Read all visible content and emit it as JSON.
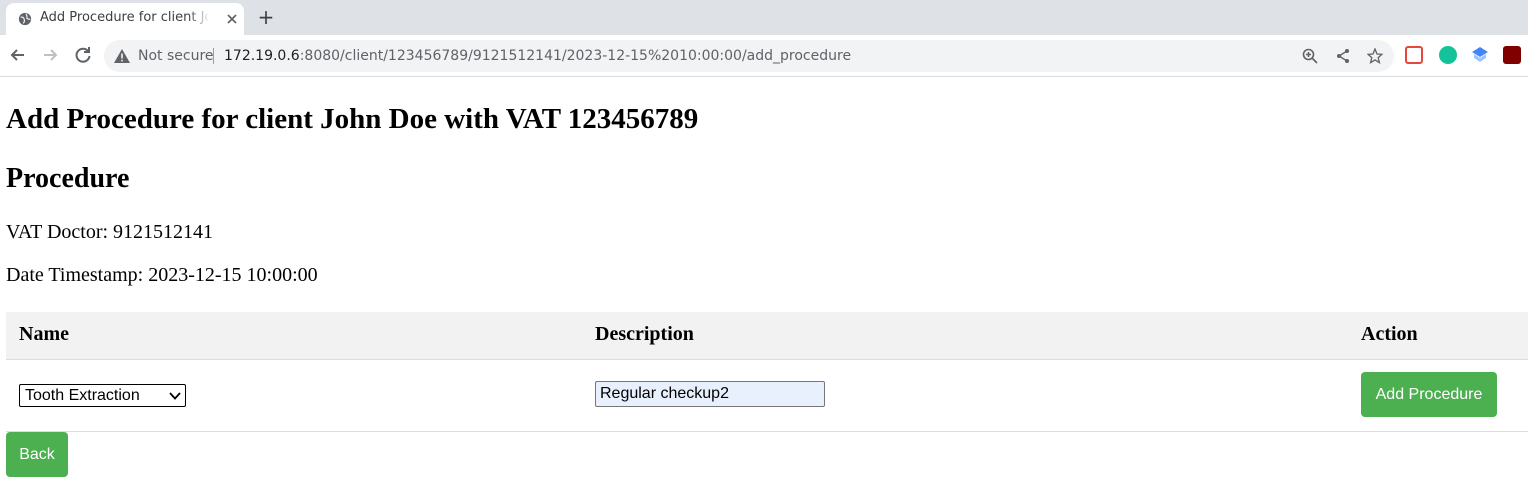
{
  "browser": {
    "tab_title": "Add Procedure for client John Doe",
    "new_tab_label": "+",
    "security_label": "Not secure",
    "url_host": "172.19.0.6",
    "url_rest": ":8080/client/123456789/9121512141/2023-12-15%2010:00:00/add_procedure",
    "icons": [
      "globe-icon",
      "close-icon",
      "back-arrow-icon",
      "forward-arrow-icon",
      "reload-icon",
      "warning-icon",
      "zoom-icon",
      "share-icon",
      "star-icon",
      "extension-icons"
    ]
  },
  "page": {
    "title": "Add Procedure for client John Doe with VAT 123456789",
    "section_title": "Procedure",
    "vat_doctor": "VAT Doctor: 9121512141",
    "date_timestamp": "Date Timestamp: 2023-12-15 10:00:00"
  },
  "table": {
    "headers": [
      "Name",
      "Description",
      "Action"
    ],
    "row": {
      "name_selected": "Tooth Extraction",
      "description_value": "Regular checkup2",
      "action_label": "Add Procedure"
    }
  },
  "back_label": "Back",
  "colors": {
    "button": "#4caf50",
    "table_header_bg": "#f2f2f2",
    "autofill_bg": "#e8f0fe"
  }
}
